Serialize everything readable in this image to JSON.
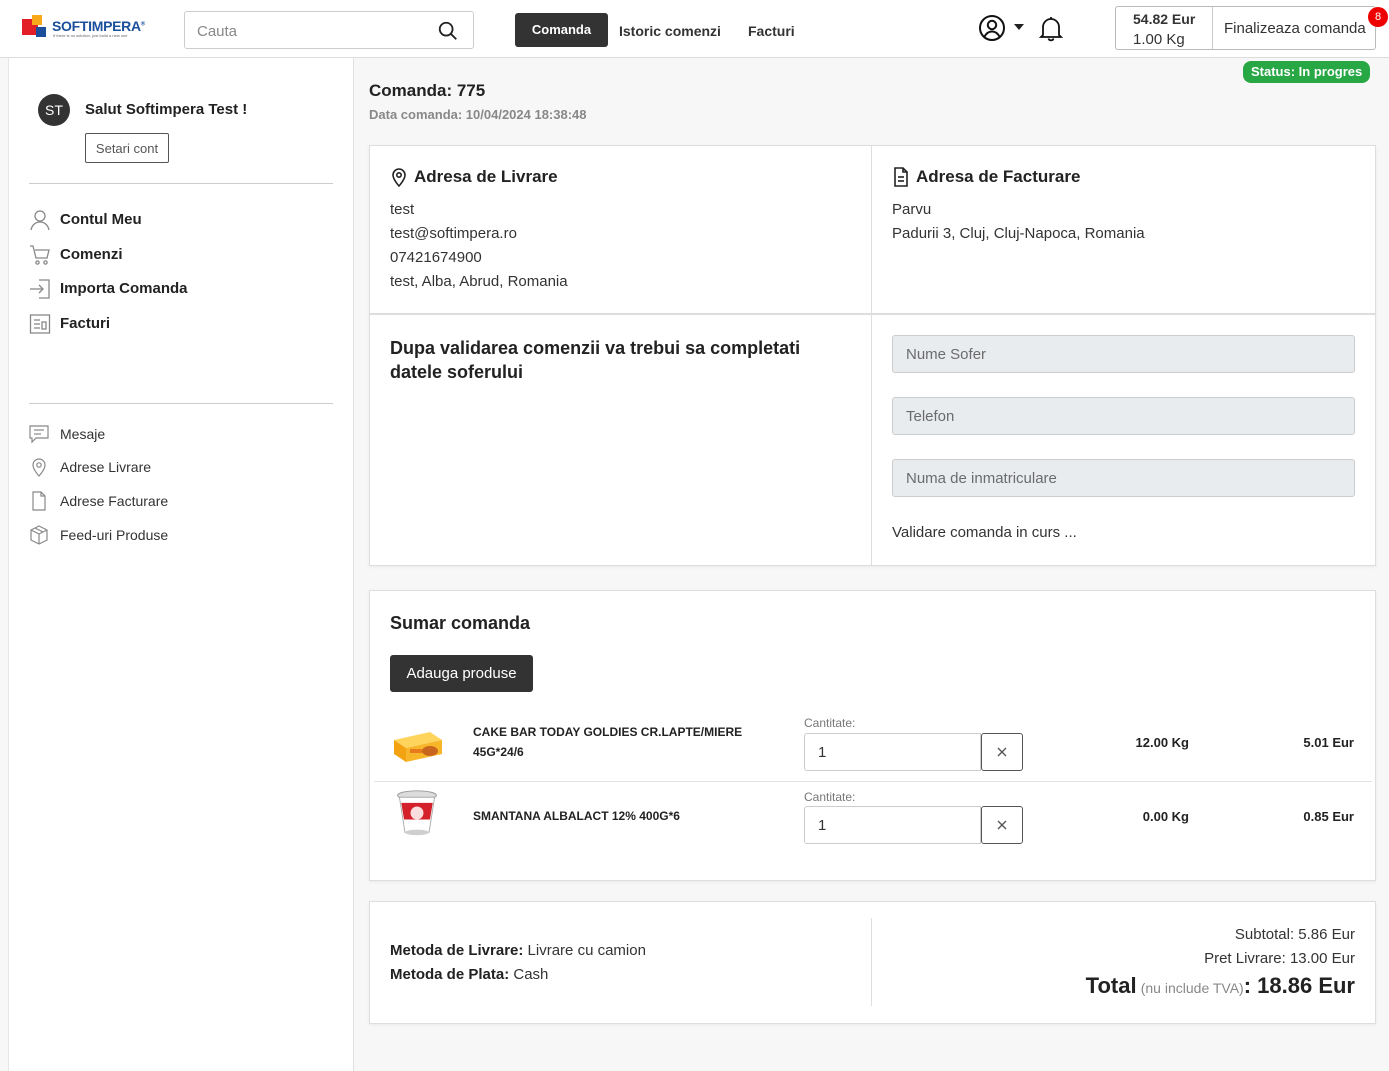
{
  "brand": {
    "name": "SOFTIMPERA",
    "registered": "®",
    "tagline": "If there is no solution, just build a new one",
    "colors": {
      "red": "#e21e26",
      "orange": "#f7a81b",
      "blue": "#1b4f9c"
    }
  },
  "header": {
    "search_placeholder": "Cauta",
    "nav": {
      "active": "Comanda",
      "history": "Istoric comenzi",
      "invoices": "Facturi"
    },
    "cart": {
      "price": "54.82 Eur",
      "weight": "1.00 Kg",
      "finalize": "Finalizeaza comanda",
      "badge": "8"
    }
  },
  "sidebar": {
    "avatar": "ST",
    "greeting": "Salut Softimpera Test !",
    "account_button": "Setari cont",
    "main_items": [
      {
        "label": "Contul Meu",
        "icon": "user-icon"
      },
      {
        "label": "Comenzi",
        "icon": "cart-icon"
      },
      {
        "label": "Importa Comanda",
        "icon": "import-icon"
      },
      {
        "label": "Facturi",
        "icon": "invoice-icon"
      }
    ],
    "secondary_items": [
      {
        "label": "Mesaje",
        "icon": "message-icon"
      },
      {
        "label": "Adrese Livrare",
        "icon": "location-icon"
      },
      {
        "label": "Adrese Facturare",
        "icon": "document-icon"
      },
      {
        "label": "Feed-uri Produse",
        "icon": "box-icon"
      }
    ]
  },
  "order": {
    "title": "Comanda: 775",
    "date": "Data comanda: 10/04/2024 18:38:48",
    "status": "Status: In progres",
    "status_color": "#28a745"
  },
  "delivery": {
    "heading": "Adresa de Livrare",
    "lines": [
      "test",
      "test@softimpera.ro",
      "07421674900",
      "test, Alba, Abrud, Romania"
    ]
  },
  "billing": {
    "heading": "Adresa de Facturare",
    "lines": [
      "Parvu",
      "Padurii 3, Cluj, Cluj-Napoca, Romania"
    ]
  },
  "driver": {
    "note": "Dupa validarea comenzii va trebui sa completati datele soferului",
    "name_placeholder": "Nume Sofer",
    "phone_placeholder": "Telefon",
    "plate_placeholder": "Numa de inmatriculare",
    "status_text": "Validare comanda in curs ..."
  },
  "summary": {
    "title": "Sumar comanda",
    "add_button": "Adauga produse",
    "qty_label": "Cantitate:",
    "products": [
      {
        "name": "CAKE BAR TODAY GOLDIES CR.LAPTE/MIERE 45G*24/6",
        "qty": "1",
        "weight": "12.00 Kg",
        "price": "5.01 Eur"
      },
      {
        "name": "SMANTANA ALBALACT 12% 400G*6",
        "qty": "1",
        "weight": "0.00 Kg",
        "price": "0.85 Eur"
      }
    ]
  },
  "payment": {
    "delivery_label": "Metoda de Livrare:",
    "delivery_value": "Livrare cu camion",
    "payment_label": "Metoda de Plata:",
    "payment_value": "Cash",
    "subtotal": "Subtotal: 5.86 Eur",
    "shipping": "Pret Livrare: 13.00 Eur",
    "total_label": "Total",
    "total_note": "(nu include TVA)",
    "total_value": ": 18.86 Eur"
  }
}
